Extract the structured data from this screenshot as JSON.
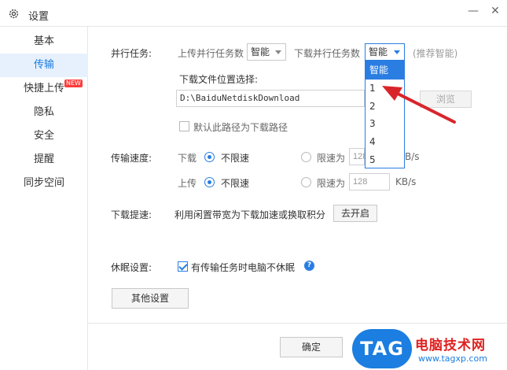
{
  "window": {
    "title": "设置",
    "minimize": "—",
    "close": "✕"
  },
  "sidebar": {
    "items": [
      {
        "label": "基本"
      },
      {
        "label": "传输"
      },
      {
        "label": "快捷上传"
      },
      {
        "label": "隐私"
      },
      {
        "label": "安全"
      },
      {
        "label": "提醒"
      },
      {
        "label": "同步空间"
      }
    ],
    "new_badge": "NEW"
  },
  "parallel": {
    "section_label": "并行任务:",
    "upload_label": "上传并行任务数",
    "upload_value": "智能",
    "download_label": "下载并行任务数",
    "download_value": "智能",
    "hint": "(推荐智能)",
    "dropdown_options": [
      "智能",
      "1",
      "2",
      "3",
      "4",
      "5"
    ]
  },
  "download_location": {
    "label": "下载文件位置选择:",
    "path": "D:\\BaiduNetdiskDownload",
    "browse_label": "浏览",
    "default_checkbox_label": "默认此路径为下载路径"
  },
  "speed": {
    "section_label": "传输速度:",
    "download": {
      "label": "下载",
      "unlimited_label": "不限速",
      "limit_label": "限速为",
      "limit_value": "128",
      "unit": "KB/s",
      "unit_partial": "B/s"
    },
    "upload": {
      "label": "上传",
      "unlimited_label": "不限速",
      "limit_label": "限速为",
      "limit_value": "128",
      "unit": "KB/s"
    }
  },
  "boost": {
    "section_label": "下载提速:",
    "description": "利用闲置带宽为下载加速或换取积分",
    "button_label": "去开启"
  },
  "sleep": {
    "section_label": "休眠设置:",
    "checkbox_label": "有传输任务时电脑不休眠",
    "help_icon_text": "?"
  },
  "other_settings_label": "其他设置",
  "footer": {
    "ok_label": "确定"
  },
  "watermark": {
    "logo_text": "TAG",
    "site_name": "电脑技术网",
    "url": "www.tagxp.com"
  },
  "colors": {
    "accent": "#2a7de1",
    "sidebar_active_bg": "#e6f1fd",
    "arrow": "#d9252a"
  }
}
